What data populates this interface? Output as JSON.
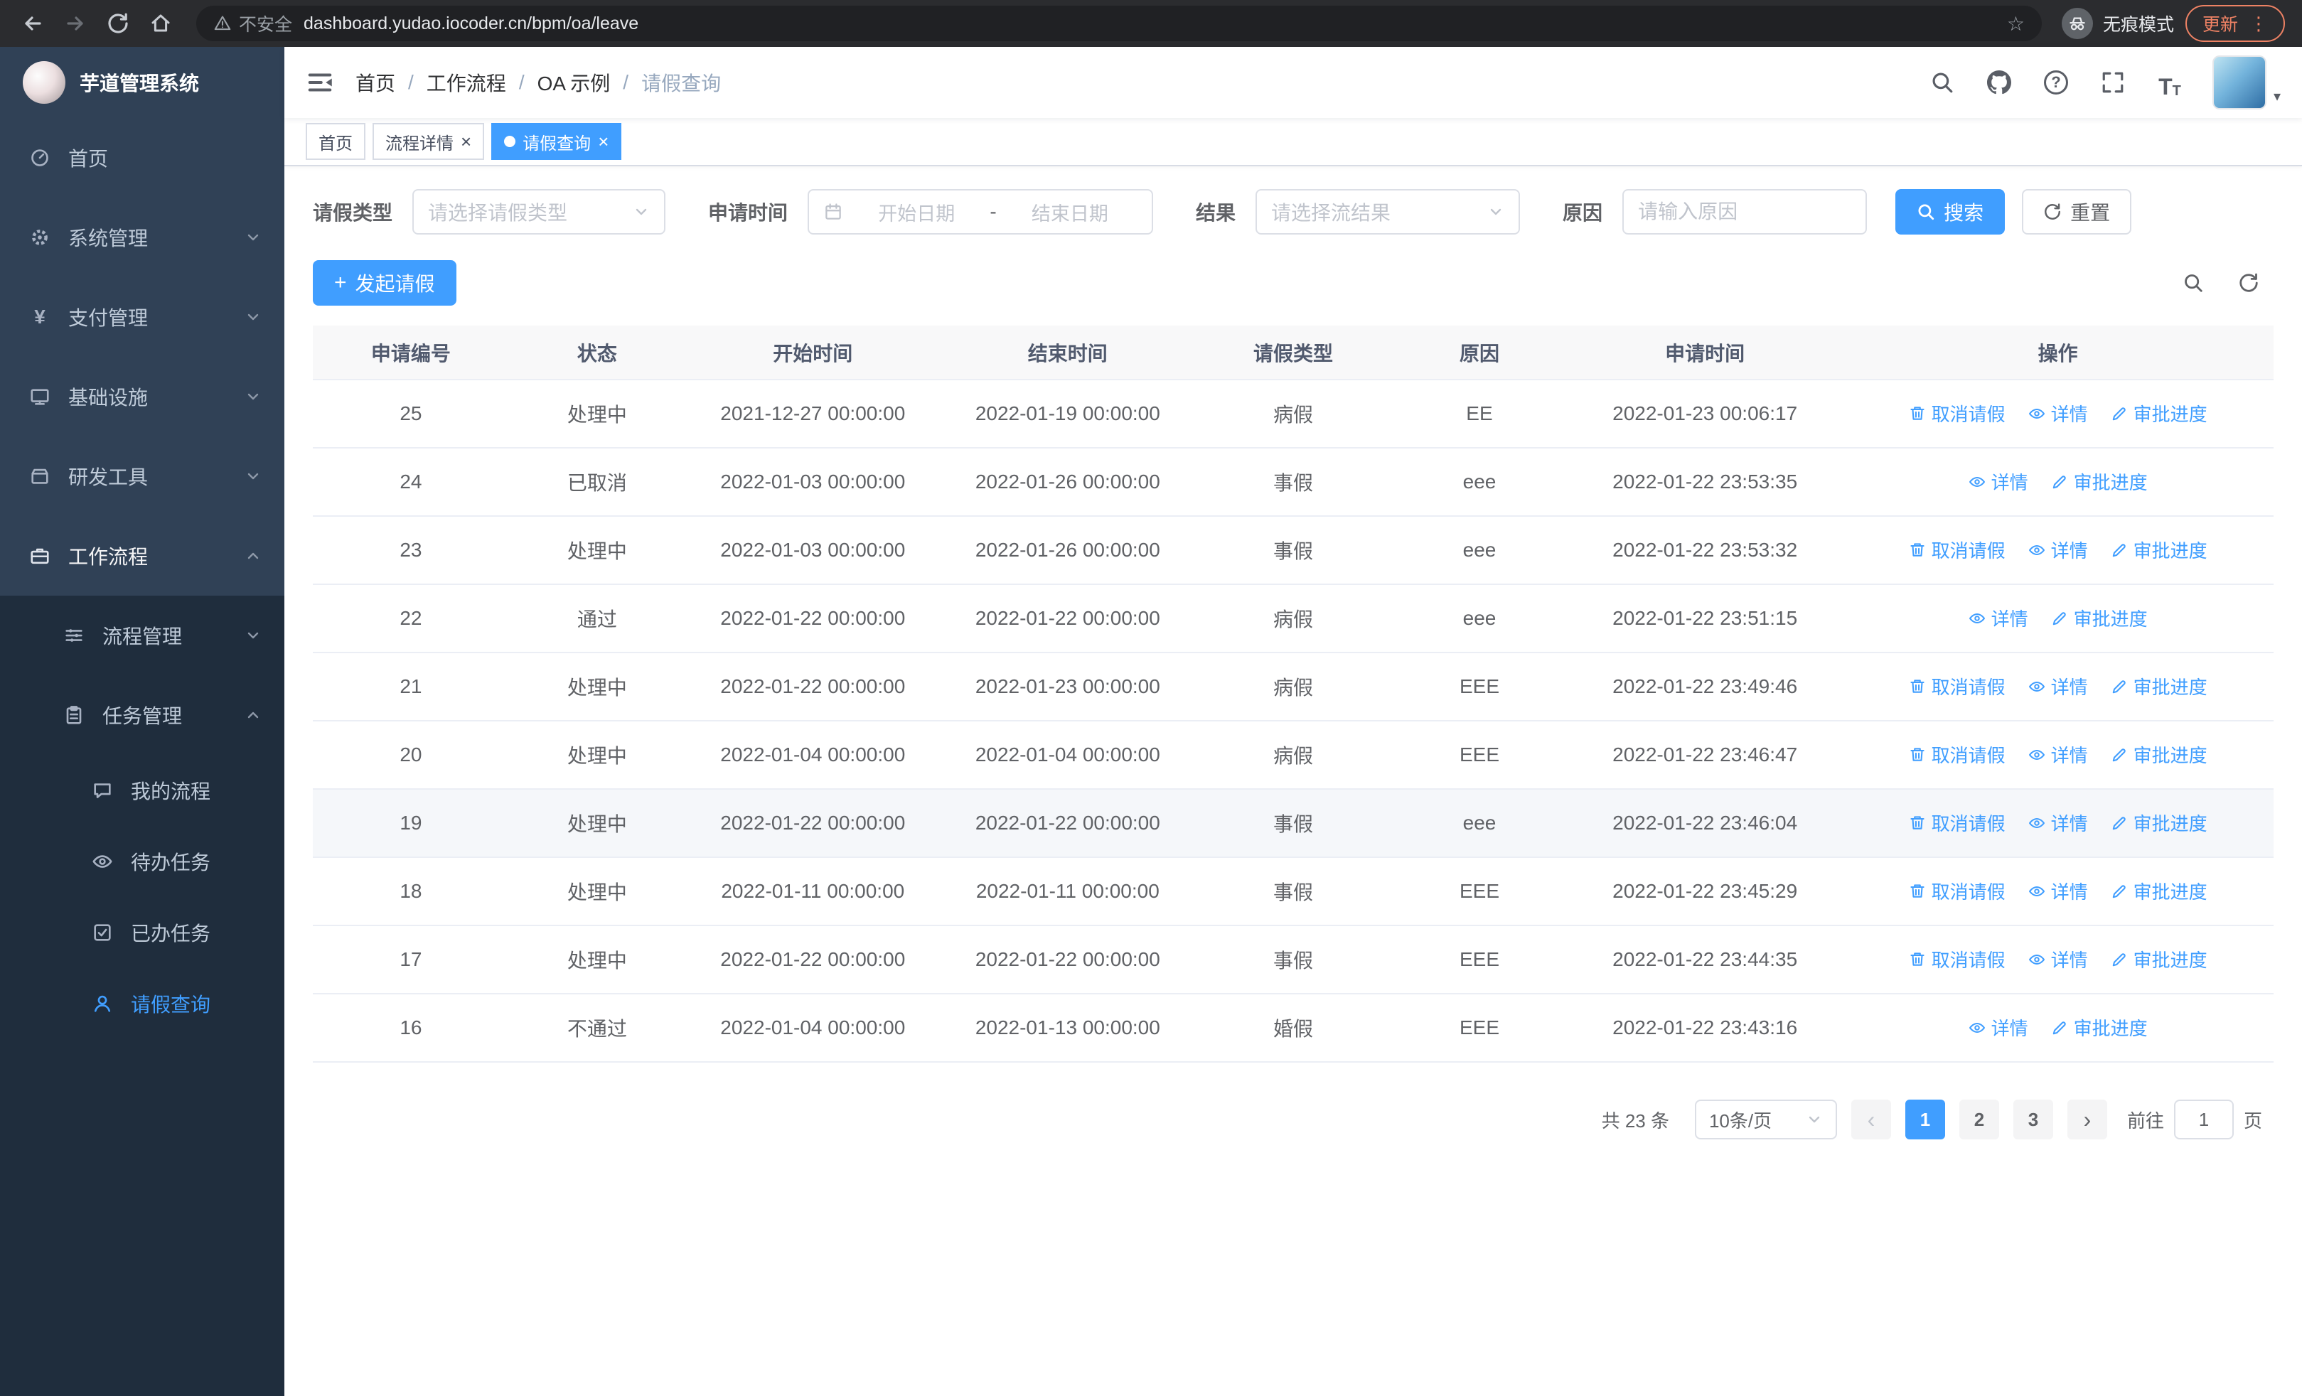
{
  "browser": {
    "security_label": "不安全",
    "url": "dashboard.yudao.iocoder.cn/bpm/oa/leave",
    "incognito_label": "无痕模式",
    "update_label": "更新"
  },
  "glyphs": {
    "star": "☆",
    "kebab": "⋮",
    "close": "×",
    "caret_down": "▾",
    "prev_arrow": "‹",
    "next_arrow": "›",
    "yen": "¥",
    "question": "?",
    "font_large": "T",
    "font_small": "T",
    "plus": "+"
  },
  "sidebar": {
    "logo_title": "芋道管理系统",
    "items": [
      {
        "label": "首页",
        "icon": "dashboard-icon"
      },
      {
        "label": "系统管理",
        "icon": "gear-icon"
      },
      {
        "label": "支付管理",
        "icon": "yen-icon"
      },
      {
        "label": "基础设施",
        "icon": "monitor-icon"
      },
      {
        "label": "研发工具",
        "icon": "toolbox-icon"
      },
      {
        "label": "工作流程",
        "icon": "briefcase-icon"
      }
    ],
    "workflow_children": [
      {
        "label": "流程管理",
        "icon": "list-icon"
      },
      {
        "label": "任务管理",
        "icon": "clipboard-icon"
      }
    ],
    "task_children": [
      {
        "label": "我的流程",
        "icon": "chat-icon"
      },
      {
        "label": "待办任务",
        "icon": "eye-icon"
      },
      {
        "label": "已办任务",
        "icon": "check-square-icon"
      },
      {
        "label": "请假查询",
        "icon": "user-icon"
      }
    ]
  },
  "header": {
    "breadcrumb": [
      "首页",
      "工作流程",
      "OA 示例",
      "请假查询"
    ],
    "separator": "/"
  },
  "tabs": [
    {
      "label": "首页"
    },
    {
      "label": "流程详情"
    },
    {
      "label": "请假查询"
    }
  ],
  "filters": {
    "leave_type_label": "请假类型",
    "leave_type_placeholder": "请选择请假类型",
    "apply_time_label": "申请时间",
    "start_date_placeholder": "开始日期",
    "range_separator": "-",
    "end_date_placeholder": "结束日期",
    "result_label": "结果",
    "result_placeholder": "请选择流结果",
    "reason_label": "原因",
    "reason_placeholder": "请输入原因",
    "search_label": "搜索",
    "reset_label": "重置"
  },
  "toolbar": {
    "create_label": "发起请假"
  },
  "table": {
    "columns": [
      "申请编号",
      "状态",
      "开始时间",
      "结束时间",
      "请假类型",
      "原因",
      "申请时间",
      "操作"
    ],
    "col_keys": [
      "id",
      "status",
      "start",
      "end",
      "type",
      "reason",
      "apply_time"
    ],
    "action_labels": {
      "cancel": "取消请假",
      "detail": "详情",
      "progress": "审批进度"
    },
    "rows": [
      {
        "id": "25",
        "status": "处理中",
        "start": "2021-12-27 00:00:00",
        "end": "2022-01-19 00:00:00",
        "type": "病假",
        "reason": "EE",
        "apply_time": "2022-01-23 00:06:17",
        "actions": [
          "cancel",
          "detail",
          "progress"
        ]
      },
      {
        "id": "24",
        "status": "已取消",
        "start": "2022-01-03 00:00:00",
        "end": "2022-01-26 00:00:00",
        "type": "事假",
        "reason": "eee",
        "apply_time": "2022-01-22 23:53:35",
        "actions": [
          "detail",
          "progress"
        ]
      },
      {
        "id": "23",
        "status": "处理中",
        "start": "2022-01-03 00:00:00",
        "end": "2022-01-26 00:00:00",
        "type": "事假",
        "reason": "eee",
        "apply_time": "2022-01-22 23:53:32",
        "actions": [
          "cancel",
          "detail",
          "progress"
        ]
      },
      {
        "id": "22",
        "status": "通过",
        "start": "2022-01-22 00:00:00",
        "end": "2022-01-22 00:00:00",
        "type": "病假",
        "reason": "eee",
        "apply_time": "2022-01-22 23:51:15",
        "actions": [
          "detail",
          "progress"
        ]
      },
      {
        "id": "21",
        "status": "处理中",
        "start": "2022-01-22 00:00:00",
        "end": "2022-01-23 00:00:00",
        "type": "病假",
        "reason": "EEE",
        "apply_time": "2022-01-22 23:49:46",
        "actions": [
          "cancel",
          "detail",
          "progress"
        ]
      },
      {
        "id": "20",
        "status": "处理中",
        "start": "2022-01-04 00:00:00",
        "end": "2022-01-04 00:00:00",
        "type": "病假",
        "reason": "EEE",
        "apply_time": "2022-01-22 23:46:47",
        "actions": [
          "cancel",
          "detail",
          "progress"
        ]
      },
      {
        "id": "19",
        "status": "处理中",
        "start": "2022-01-22 00:00:00",
        "end": "2022-01-22 00:00:00",
        "type": "事假",
        "reason": "eee",
        "apply_time": "2022-01-22 23:46:04",
        "actions": [
          "cancel",
          "detail",
          "progress"
        ],
        "hover": true
      },
      {
        "id": "18",
        "status": "处理中",
        "start": "2022-01-11 00:00:00",
        "end": "2022-01-11 00:00:00",
        "type": "事假",
        "reason": "EEE",
        "apply_time": "2022-01-22 23:45:29",
        "actions": [
          "cancel",
          "detail",
          "progress"
        ]
      },
      {
        "id": "17",
        "status": "处理中",
        "start": "2022-01-22 00:00:00",
        "end": "2022-01-22 00:00:00",
        "type": "事假",
        "reason": "EEE",
        "apply_time": "2022-01-22 23:44:35",
        "actions": [
          "cancel",
          "detail",
          "progress"
        ]
      },
      {
        "id": "16",
        "status": "不通过",
        "start": "2022-01-04 00:00:00",
        "end": "2022-01-13 00:00:00",
        "type": "婚假",
        "reason": "EEE",
        "apply_time": "2022-01-22 23:43:16",
        "actions": [
          "detail",
          "progress"
        ]
      }
    ]
  },
  "pagination": {
    "total_text": "共 23 条",
    "page_size_text": "10条/页",
    "pages": [
      "1",
      "2",
      "3"
    ],
    "active_page": "1",
    "goto_label": "前往",
    "goto_value": "1",
    "page_suffix": "页"
  },
  "colors": {
    "primary": "#409eff",
    "sidebar_bg": "#304156",
    "submenu_bg": "#1f2d3d",
    "header_row_bg": "#f8f8f9"
  }
}
